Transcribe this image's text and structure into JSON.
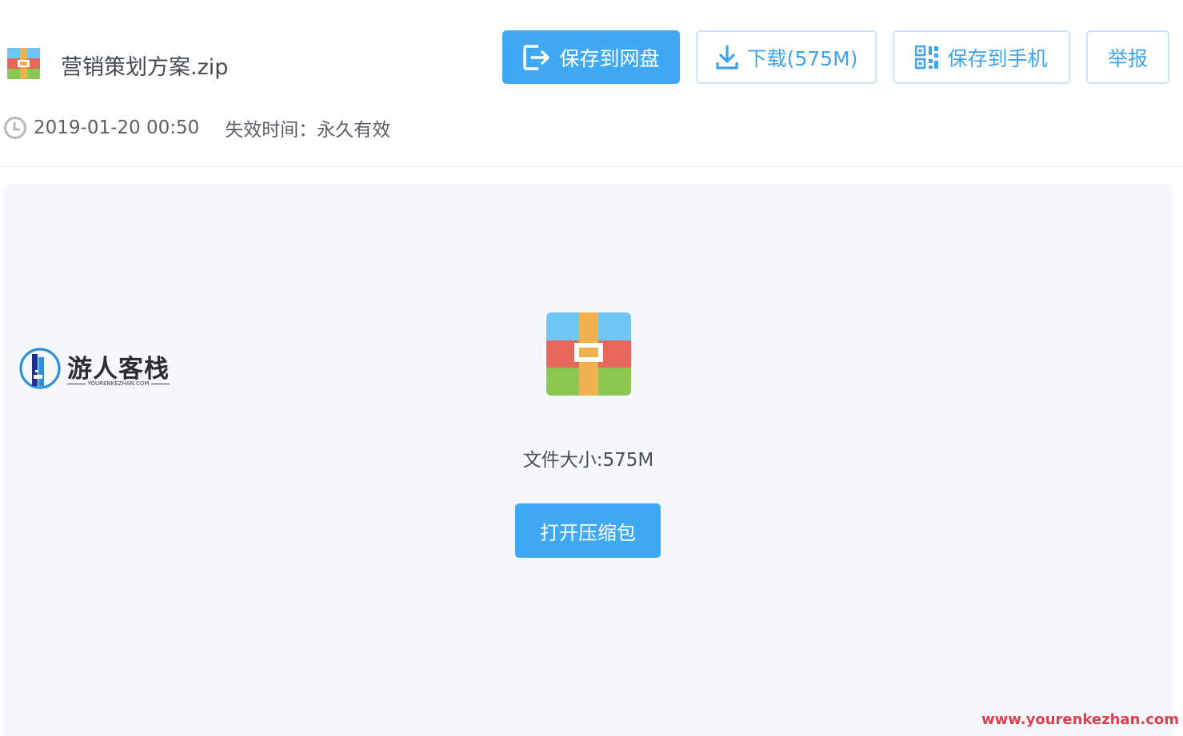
{
  "file": {
    "name": "营销策划方案.zip",
    "icon": "zip-archive-icon",
    "uploaded_at": "2019-01-20 00:50",
    "expiry": "失效时间：永久有效",
    "size_label": "文件大小:575M"
  },
  "actions": {
    "save_to_drive": "保存到网盘",
    "download": "下载(575M)",
    "save_to_phone": "保存到手机",
    "report": "举报",
    "open_archive": "打开压缩包"
  },
  "logo": {
    "name": "游人客栈",
    "subtitle": "YOURENKEZHAN.COM"
  },
  "watermark": "www.yourenkezhan.com",
  "colors": {
    "primary": "#3fa9f5",
    "outline_border": "#c8e4f8",
    "preview_bg": "#f6f8fb",
    "watermark": "#e03e4e",
    "zip_top": "#6ec6f5",
    "zip_middle": "#e8665b",
    "zip_bottom": "#8cc751",
    "zip_band": "#f2b14f"
  }
}
